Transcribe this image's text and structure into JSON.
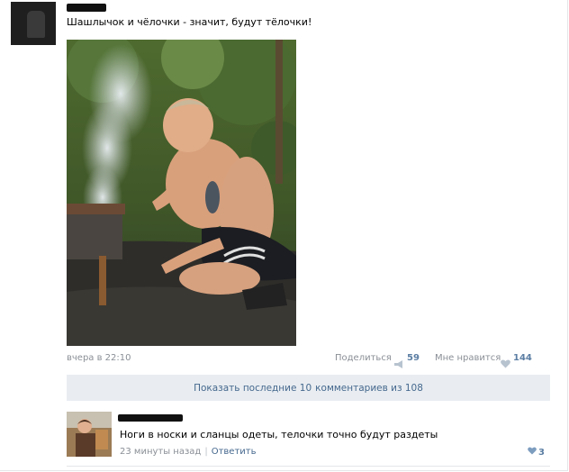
{
  "post": {
    "text": "Шашлычок и чёлочки - значит, будут тёлочки!",
    "time": "вчера в 22:10",
    "share_label": "Поделиться",
    "share_count": "59",
    "like_label": "Мне нравится",
    "like_count": "144"
  },
  "comments_bar": {
    "show_last": "Показать последние 10",
    "of_total": "комментариев из 108"
  },
  "comment": {
    "text": "Ноги в носки и сланцы одеты, телочки точно будут раздеты",
    "time": "23 минуты назад",
    "reply_label": "Ответить",
    "like_count": "3"
  },
  "icons": {
    "share": "megaphone-icon",
    "like": "heart-icon"
  },
  "colors": {
    "link": "#45688e",
    "count": "#5b7ea3",
    "muted": "#8a8f96",
    "bar_bg": "#e9edf1"
  }
}
